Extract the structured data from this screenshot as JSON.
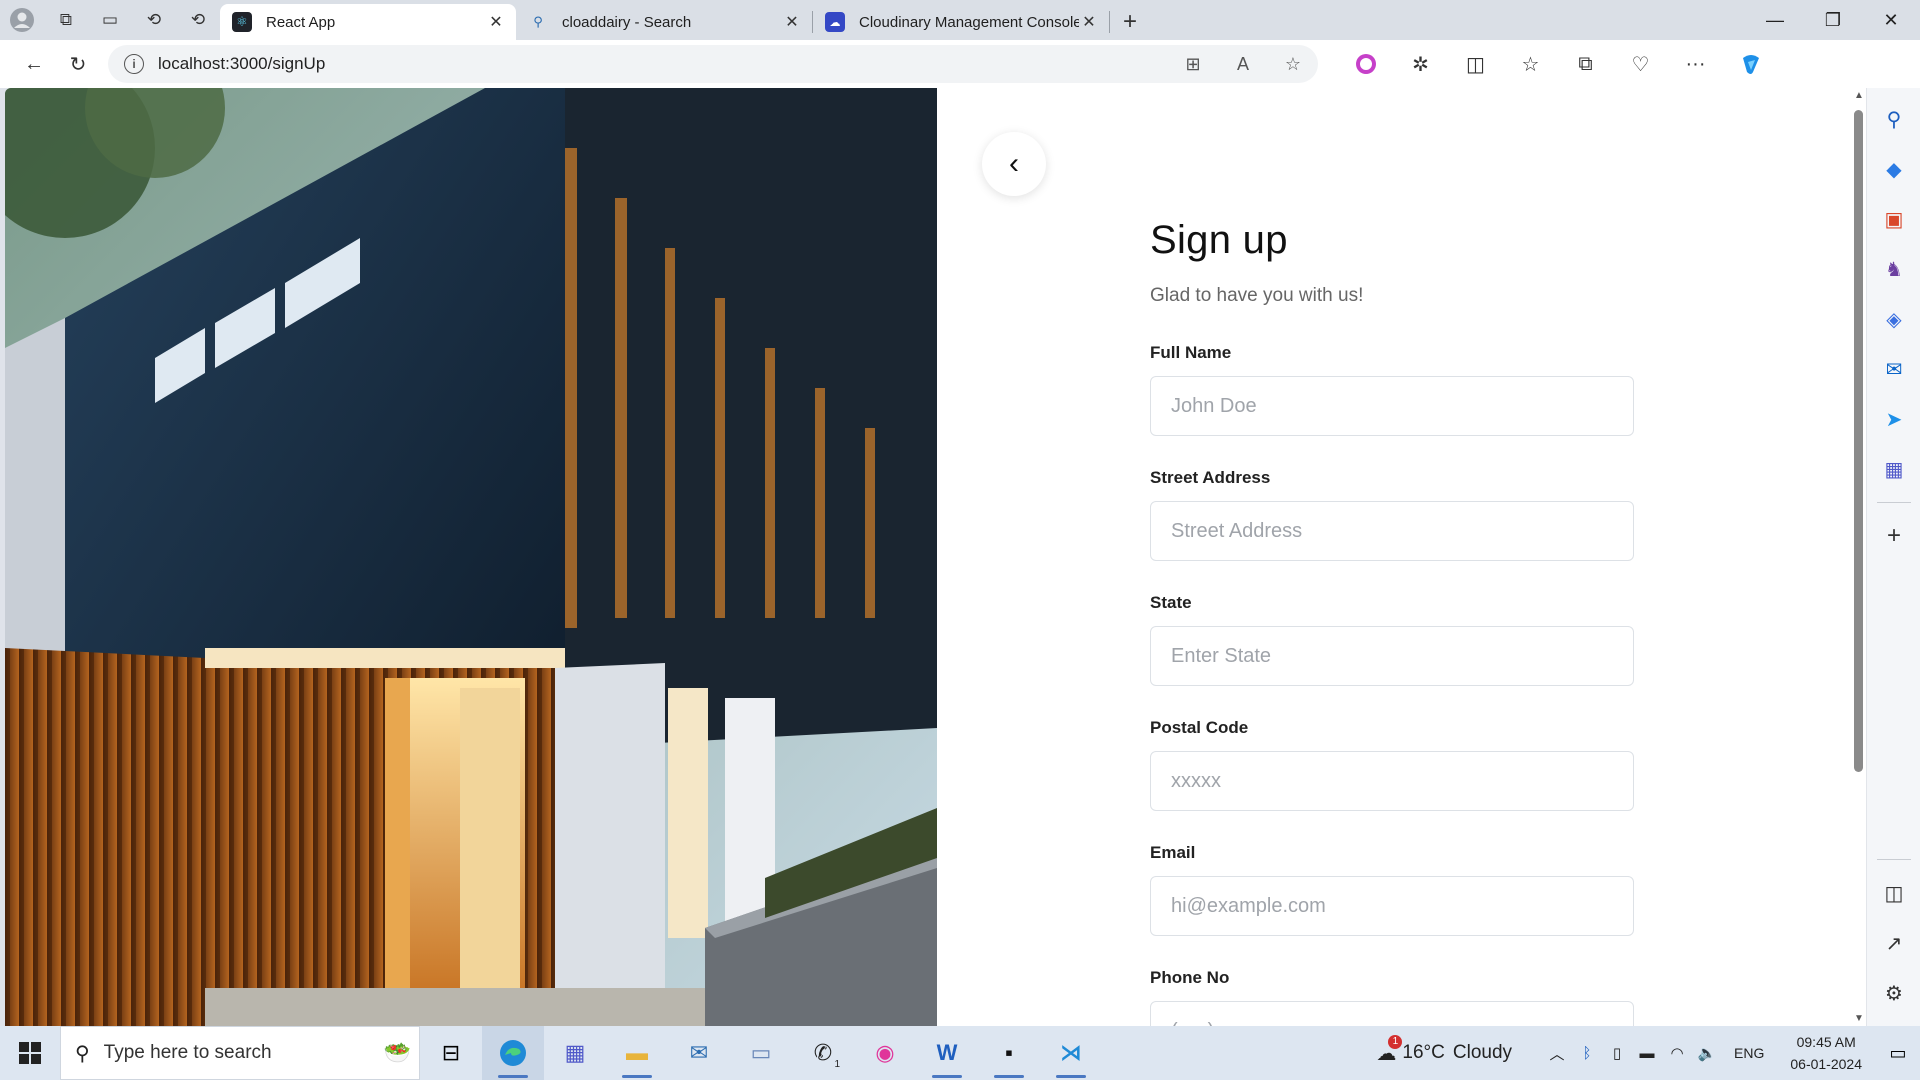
{
  "browser": {
    "tabs": [
      {
        "title": "React App",
        "favicon": "react-icon",
        "active": true
      },
      {
        "title": "cloaddairy - Search",
        "favicon": "search-icon",
        "active": false
      },
      {
        "title": "Cloudinary Management Console",
        "favicon": "cloudinary-icon",
        "active": false
      }
    ],
    "url": "localhost:3000/signUp"
  },
  "signup": {
    "title": "Sign up",
    "subtitle": "Glad to have you with us!",
    "fields": [
      {
        "label": "Full Name",
        "placeholder": "John Doe"
      },
      {
        "label": "Street Address",
        "placeholder": "Street Address"
      },
      {
        "label": "State",
        "placeholder": "Enter State"
      },
      {
        "label": "Postal Code",
        "placeholder": "xxxxx"
      },
      {
        "label": "Email",
        "placeholder": "hi@example.com"
      },
      {
        "label": "Phone No",
        "placeholder": "(xxx) xxx-xxxx"
      }
    ]
  },
  "taskbar": {
    "search_placeholder": "Type here to search",
    "weather": {
      "temp": "16°C",
      "condition": "Cloudy",
      "alert_count": "1"
    },
    "language": "ENG",
    "time": "09:45 AM",
    "date": "06-01-2024",
    "whatsapp_badge": "1"
  },
  "colors": {
    "accent": "#0067c0",
    "placeholder": "#a0a4aa"
  }
}
